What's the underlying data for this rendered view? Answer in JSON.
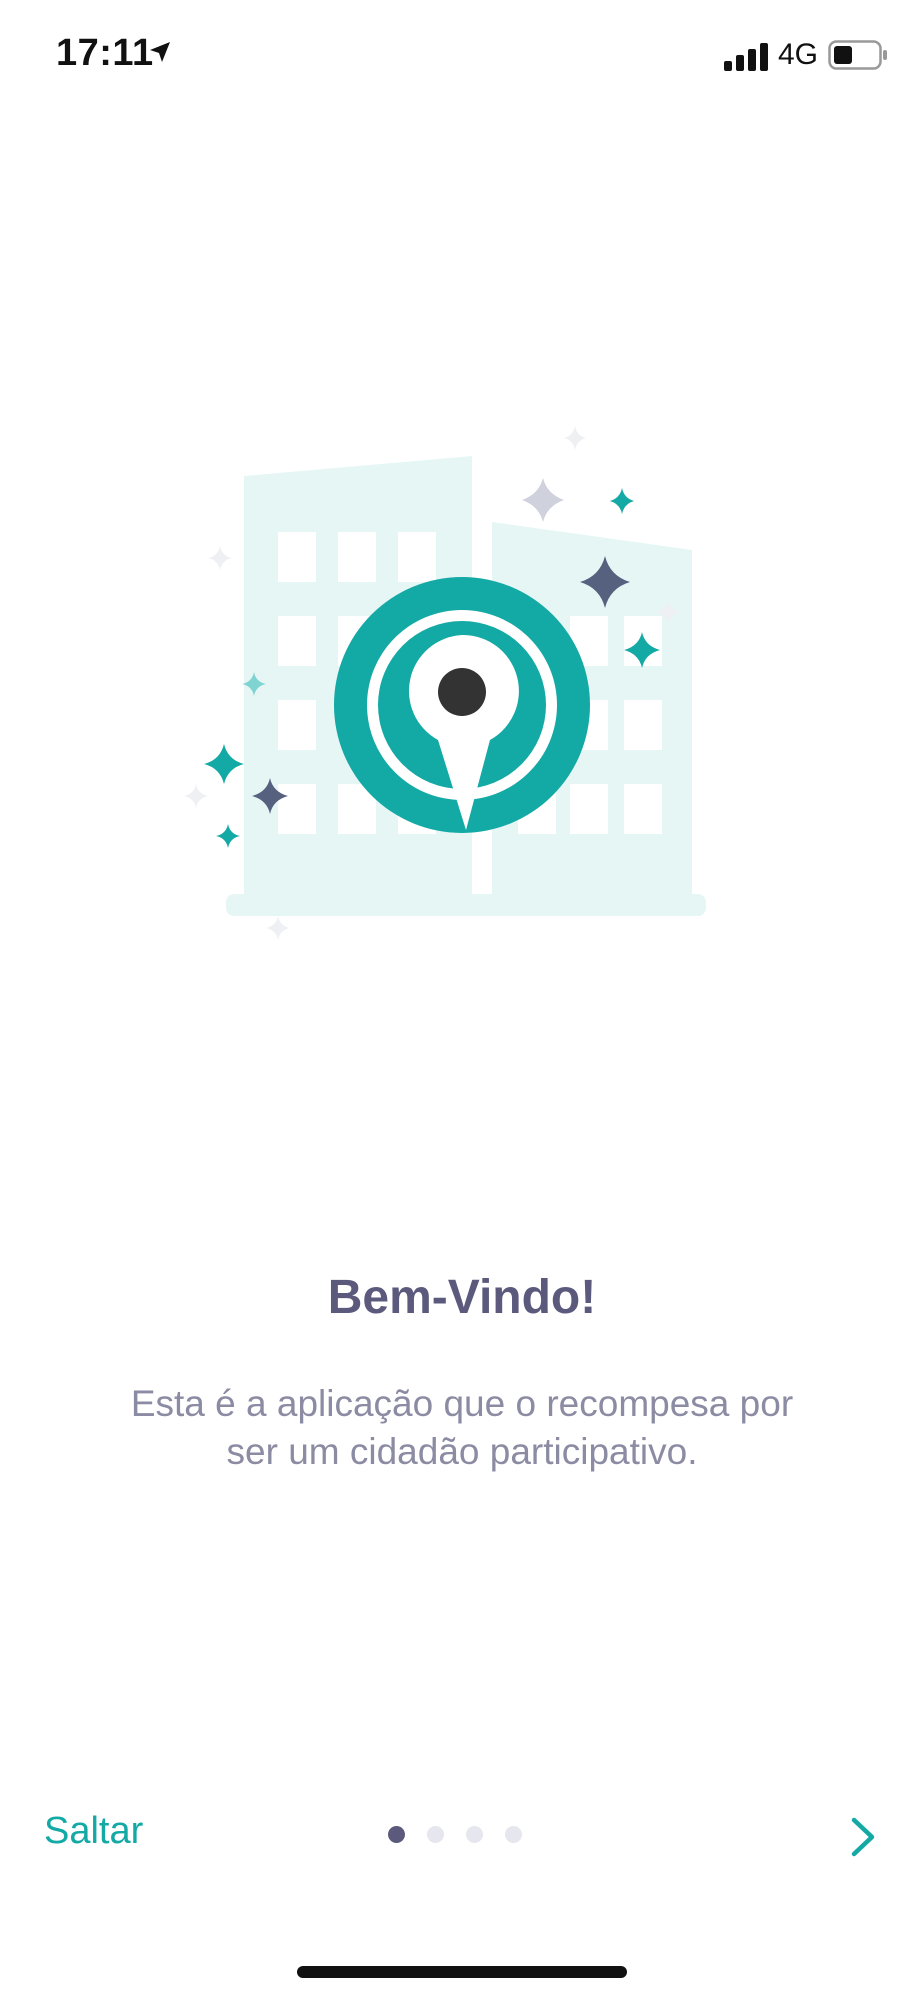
{
  "status_bar": {
    "time": "17:11",
    "network": "4G",
    "icons": [
      "location-arrow-icon",
      "cellular-signal-icon",
      "battery-icon"
    ]
  },
  "onboarding": {
    "title": "Bem-Vindo!",
    "description": "Esta é a aplicação que o recompesa por ser um cidadão participativo."
  },
  "navigation": {
    "skip_label": "Saltar",
    "page_count": 4,
    "current_page": 1,
    "next_icon": "chevron-right-icon"
  },
  "colors": {
    "accent": "#13a9a5",
    "title": "#5b5a7d",
    "text": "#8b8ba3",
    "building": "#e6f6f5",
    "dark_star": "#56607f"
  }
}
